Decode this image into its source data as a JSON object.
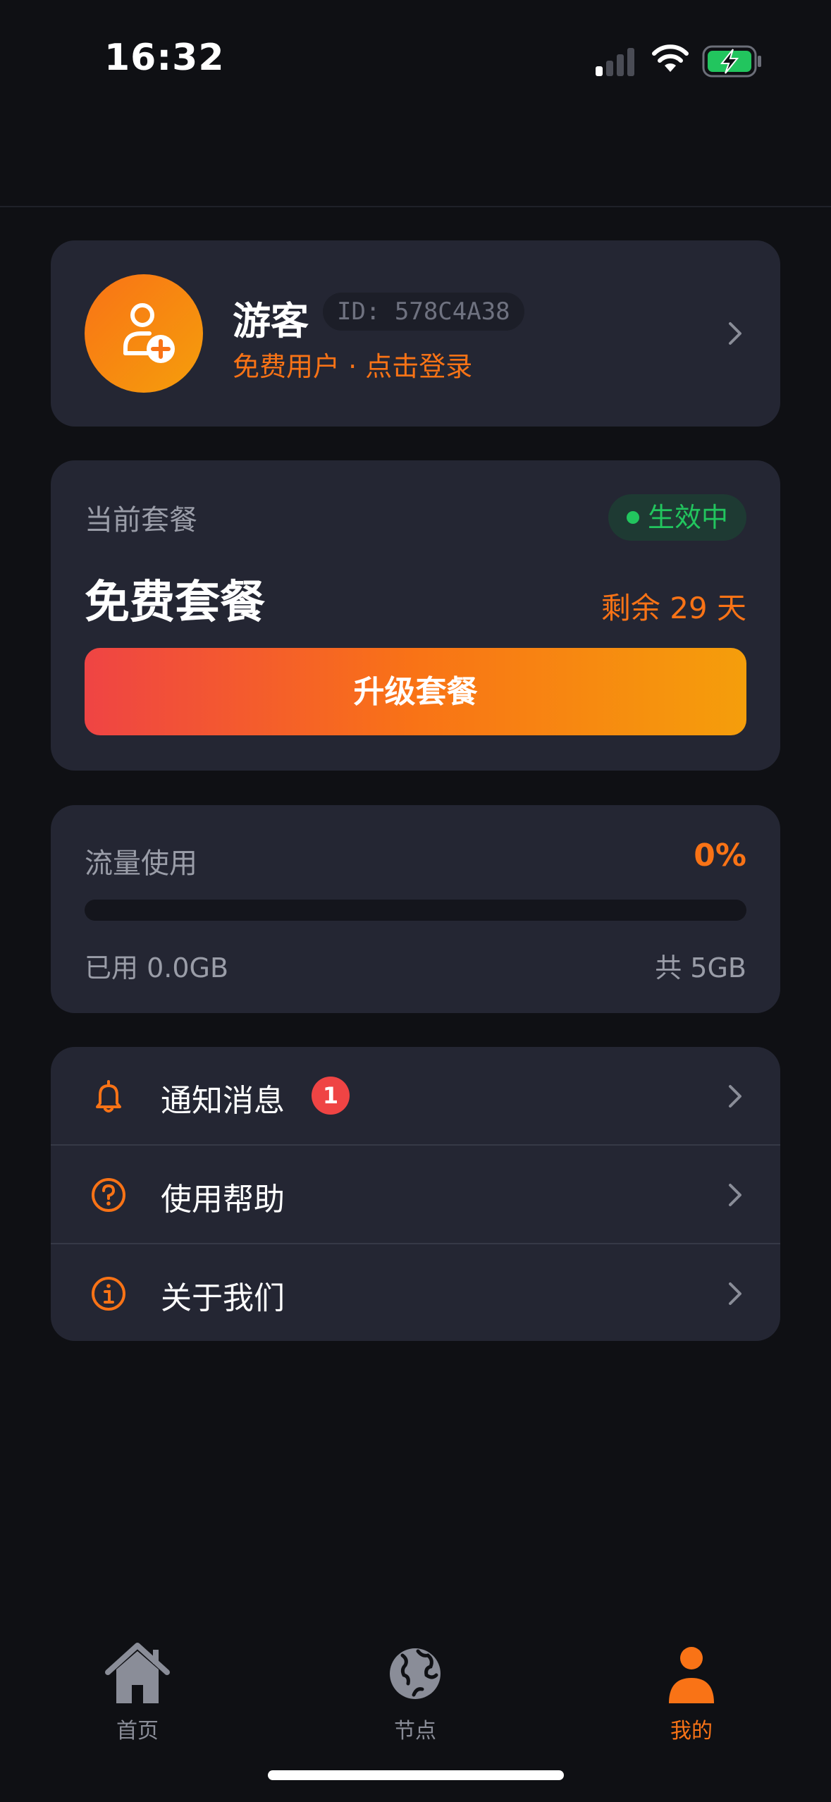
{
  "status_bar": {
    "time": "16:32"
  },
  "profile": {
    "name": "游客",
    "id": "ID: 578C4A38",
    "subtitle": "免费用户 · 点击登录"
  },
  "plan": {
    "label": "当前套餐",
    "status": "生效中",
    "name": "免费套餐",
    "remaining": "剩余 29 天",
    "upgrade_label": "升级套餐"
  },
  "traffic": {
    "label": "流量使用",
    "percent_text": "0%",
    "percent_value": 0,
    "used": "已用 0.0GB",
    "total": "共 5GB"
  },
  "menu": {
    "items": [
      {
        "label": "通知消息",
        "icon": "bell-icon",
        "badge": "1"
      },
      {
        "label": "使用帮助",
        "icon": "help-circle-icon"
      },
      {
        "label": "关于我们",
        "icon": "info-circle-icon"
      }
    ]
  },
  "tabs": [
    {
      "label": "首页",
      "icon": "home-icon",
      "active": false
    },
    {
      "label": "节点",
      "icon": "globe-icon",
      "active": false
    },
    {
      "label": "我的",
      "icon": "user-icon",
      "active": true
    }
  ],
  "colors": {
    "accent": "#f97316",
    "background": "#0f1014",
    "card": "#242633",
    "success": "#22c55e",
    "badge": "#ef4444"
  }
}
